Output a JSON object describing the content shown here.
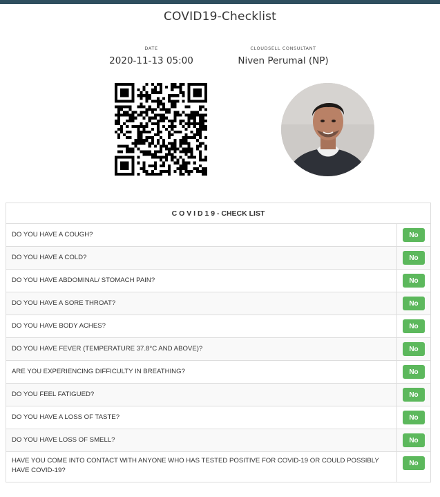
{
  "header": {
    "title": "COVID19-Checklist"
  },
  "meta": {
    "date_label": "DATE",
    "date_value": "2020-11-13 05:00",
    "consultant_label": "CLOUDSELL CONSULTANT",
    "consultant_value": "Niven Perumal (NP)"
  },
  "images": {
    "qr_code": "qr-code-icon",
    "avatar": "consultant-photo"
  },
  "checklist": {
    "heading": "C O V I D 1 9 - CHECK LIST",
    "rows": [
      {
        "question": "DO YOU HAVE A COUGH?",
        "answer": "No"
      },
      {
        "question": "DO YOU HAVE A COLD?",
        "answer": "No"
      },
      {
        "question": "DO YOU HAVE ABDOMINAL/ STOMACH PAIN?",
        "answer": "No"
      },
      {
        "question": "DO YOU HAVE A SORE THROAT?",
        "answer": "No"
      },
      {
        "question": "DO YOU HAVE BODY ACHES?",
        "answer": "No"
      },
      {
        "question": "DO YOU HAVE FEVER (TEMPERATURE 37.8°C AND ABOVE)?",
        "answer": "No"
      },
      {
        "question": "ARE YOU EXPERIENCING DIFFICULTY IN BREATHING?",
        "answer": "No"
      },
      {
        "question": "DO YOU FEEL FATIGUED?",
        "answer": "No"
      },
      {
        "question": "DO YOU HAVE A LOSS OF TASTE?",
        "answer": "No"
      },
      {
        "question": "DO YOU HAVE LOSS OF SMELL?",
        "answer": "No"
      },
      {
        "question": "HAVE YOU COME INTO CONTACT WITH ANYONE WHO HAS TESTED POSITIVE FOR COVID-19 OR COULD POSSIBLY HAVE COVID-19?",
        "answer": "No"
      }
    ]
  },
  "colors": {
    "accent": "#5cb85c",
    "topbar": "#2f4f5f",
    "border": "#dddddd",
    "stripe": "#f9f9f9"
  }
}
